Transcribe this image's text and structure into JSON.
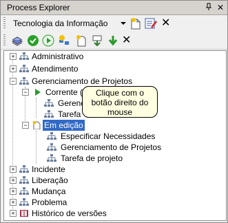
{
  "window": {
    "title": "Process Explorer"
  },
  "title_buttons": {
    "pin": "ᵠ",
    "close": "✕"
  },
  "selector": {
    "value": "Tecnologia da Informação"
  },
  "toolbar_icons": [
    "books-icon",
    "check-circle-icon",
    "play-icon",
    "new-process-icon",
    "new-item-icon",
    "move-down-icon",
    "move-down-green-icon",
    "delete-icon"
  ],
  "tree": {
    "items": [
      {
        "label": "Administrativo"
      },
      {
        "label": "Atendimento"
      },
      {
        "label": "Gerenciamento de Projetos"
      },
      {
        "label": "Corrente (v"
      },
      {
        "label": "Gerenc"
      },
      {
        "label": "Tarefa"
      },
      {
        "label": "Em edição"
      },
      {
        "label": "Especificar Necessidades"
      },
      {
        "label": "Gerenciamento de Projetos"
      },
      {
        "label": "Tarefa de projeto"
      },
      {
        "label": "Incidente"
      },
      {
        "label": "Liberação"
      },
      {
        "label": "Mudança"
      },
      {
        "label": "Problema"
      },
      {
        "label": "Histórico de versões"
      }
    ]
  },
  "tooltip": {
    "line1": "Clique com o",
    "line2": "botão direito do",
    "line3": "mouse"
  },
  "colors": {
    "selection": "#3169c6",
    "tooltip_bg": "#ffffe1"
  }
}
